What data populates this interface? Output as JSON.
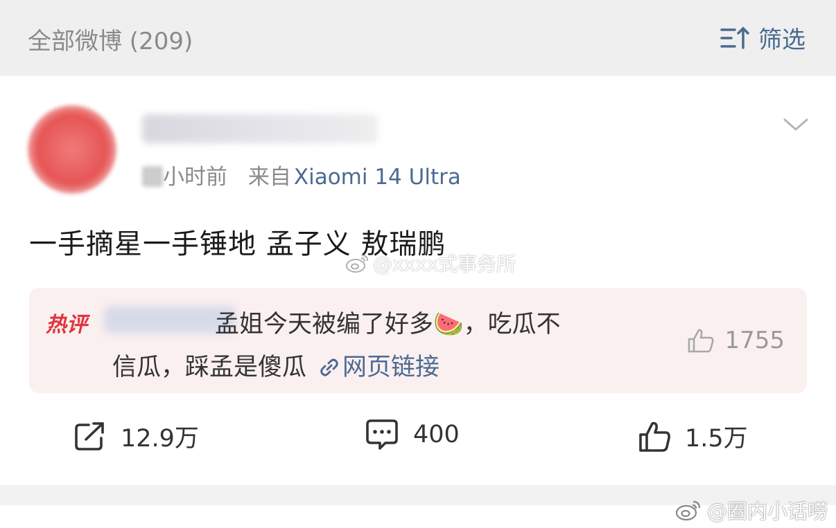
{
  "header": {
    "title": "全部微博 (209)",
    "filter_label": "筛选",
    "filter_icon": "sort-filter-icon"
  },
  "post": {
    "avatar_icon": "user-avatar",
    "time_text": "小时前",
    "source_prefix": "来自",
    "device": "Xiaomi 14 Ultra",
    "text": "一手摘星一手锤地  孟子义 敖瑞鹏",
    "watermark": "@xxxx式事务所",
    "hot_comment": {
      "badge": "热评",
      "line1": "孟姐今天被编了好多🍉，吃瓜不",
      "line2": "信瓜，踩孟是傻瓜",
      "link_label": "网页链接",
      "likes": "1755"
    },
    "actions": {
      "repost": "12.9万",
      "comments": "400",
      "likes": "1.5万"
    }
  },
  "bottom_watermark": "@圈内小话唠",
  "colors": {
    "accent": "#4a6a92",
    "hot_red": "#e0343e",
    "hot_bg": "#fbf0f0"
  }
}
